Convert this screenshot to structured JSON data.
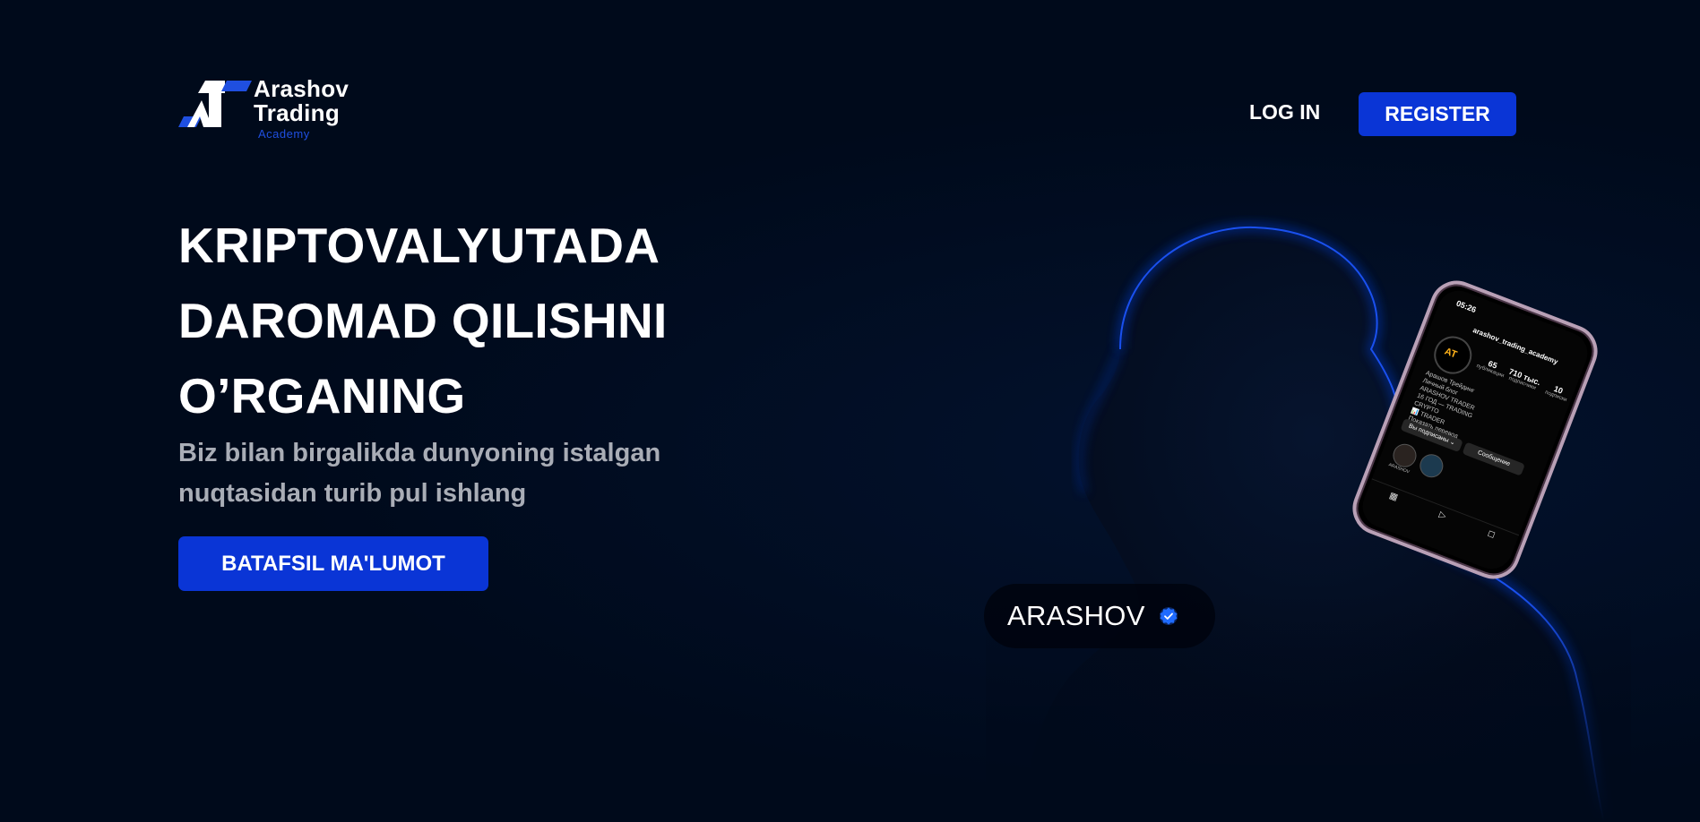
{
  "header": {
    "logo": {
      "line1": "Arashov",
      "line2": "Trading",
      "sub": "Academy"
    },
    "login_label": "LOG IN",
    "register_label": "REGISTER"
  },
  "hero": {
    "title_lines": [
      "KRIPTOVALYUTADA",
      "DAROMAD QILISHNI",
      "O’RGANING"
    ],
    "subtitle": "Biz bilan birgalikda dunyoning istalgan nuqtasidan turib pul ishlang",
    "cta_label": "BATAFSIL MA'LUMOT"
  },
  "illustration": {
    "name_badge": "ARASHOV",
    "phone": {
      "time": "05:26",
      "username": "arashov_trading_academy",
      "stats": [
        {
          "num": "65",
          "label": "публикации"
        },
        {
          "num": "710 тыс.",
          "label": "подписчики"
        },
        {
          "num": "10",
          "label": "подписки"
        }
      ],
      "bio": [
        "Арашов Трейдинг",
        "Личный блог",
        "ARASHOV TRADER",
        "16 ГОД — TRADING",
        "CRYPTO",
        "📊 TRADER",
        "Показать перевод",
        "🔗 t.me/arashovtrading"
      ],
      "follow_label": "Вы подписаны ⌄",
      "message_label": "Сообщение",
      "highlight_label": "ARASHOV",
      "avatar_mark": "AT"
    }
  },
  "colors": {
    "background": "#000a1b",
    "accent": "#0a35d6",
    "logo_blue": "#1f4fe0",
    "subtitle_gray": "#a9adb6"
  },
  "icons": {
    "logo": "at-logo-icon",
    "verified": "verified-badge-icon"
  }
}
